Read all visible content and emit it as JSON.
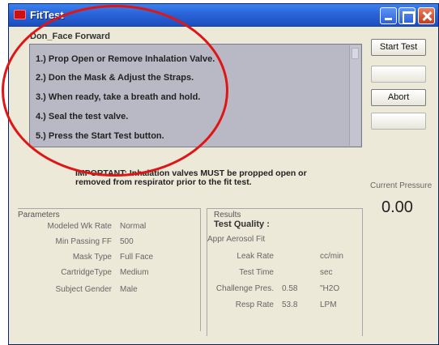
{
  "window": {
    "title": "FitTest"
  },
  "header": {
    "subtitle": "Don_Face Forward"
  },
  "instructions": [
    "1.) Prop Open or Remove Inhalation Valve.",
    "2.) Don the Mask & Adjust the Straps.",
    "3.) When ready, take a breath and hold.",
    "4.) Seal the test valve.",
    "5.) Press the Start Test button."
  ],
  "buttons": {
    "start_test": "Start Test",
    "second": "",
    "abort": "Abort",
    "fourth": ""
  },
  "important_note": "IMPORTANT: Inhalation valves MUST be propped open or removed from respirator prior to the fit test.",
  "pressure": {
    "label": "Current Pressure",
    "value": "0.00"
  },
  "parameters": {
    "heading": "Parameters",
    "rows": [
      {
        "label": "Modeled Wk Rate",
        "value": "Normal"
      },
      {
        "label": "Min Passing FF",
        "value": "500"
      },
      {
        "label": "Mask Type",
        "value": "Full Face"
      },
      {
        "label": "CartridgeType",
        "value": "Medium"
      },
      {
        "label": "Subject Gender",
        "value": "Male"
      }
    ]
  },
  "results": {
    "heading": "Results",
    "test_quality_label": "Test Quality :",
    "appr_aerosol_label": "Appr Aerosol Fit",
    "rows": [
      {
        "label": "Leak Rate",
        "value": "",
        "unit": "cc/min"
      },
      {
        "label": "Test Time",
        "value": "",
        "unit": "sec"
      },
      {
        "label": "Challenge Pres.",
        "value": "0.58",
        "unit": "\"H2O"
      },
      {
        "label": "Resp Rate",
        "value": "53.8",
        "unit": "LPM"
      }
    ]
  },
  "colors": {
    "annotation": "#e01515",
    "titlebar": "#2a63d8",
    "instructions_bg": "#b9b9c6"
  }
}
